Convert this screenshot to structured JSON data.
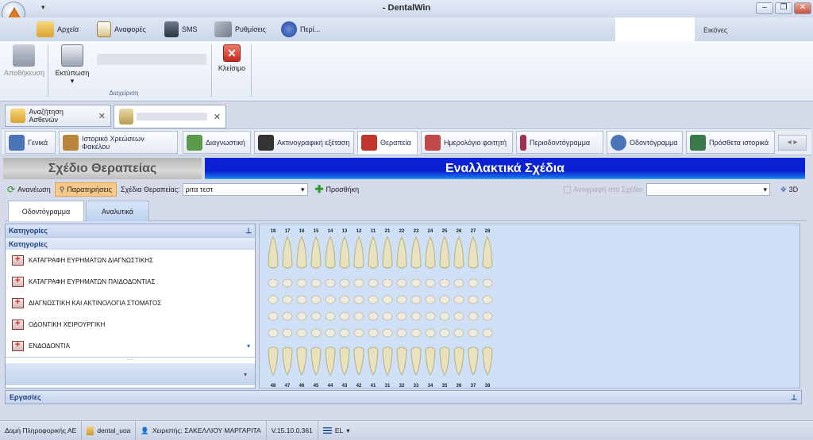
{
  "window": {
    "title": "- DentalWin",
    "qat_arrow": "▾",
    "min": "–",
    "restore": "❐",
    "close": "✕"
  },
  "menu": [
    {
      "label": "Αρχεία",
      "icon": "folder-icon"
    },
    {
      "label": "Αναφορές",
      "icon": "clipboard-icon"
    },
    {
      "label": "SMS",
      "icon": "phone-icon"
    },
    {
      "label": "Ρυθμίσεις",
      "icon": "tools-icon"
    },
    {
      "label": "Περί...",
      "icon": "info-icon"
    }
  ],
  "eikones": "Εικόνες",
  "ribbon": {
    "save": "Αποθήκευση",
    "print": "Εκτύπωση",
    "print_arrow": "▾",
    "close": "Κλείσιμο",
    "group": "Διαχείριση"
  },
  "doctabs": {
    "search": "Αναζήτηση Ασθενών",
    "x": "✕"
  },
  "sections": [
    {
      "label": "Γενικά",
      "color": "#4a73b8"
    },
    {
      "label": "Ιστορικό Χρεώσεων Φακέλου",
      "color": "#b9853a"
    },
    {
      "label": "Διαγνωστική",
      "color": "#5a9a4a"
    },
    {
      "label": "Ακτινογραφική εξέταση",
      "color": "#333333"
    },
    {
      "label": "Θεραπεία",
      "color": "#c2342c"
    },
    {
      "label": "Ημερολόγιο φοιτητή",
      "color": "#c04a4a"
    },
    {
      "label": "Περιοδοντόγραμμα",
      "color": "#a03050"
    },
    {
      "label": "Οδοντόγραμμα",
      "color": "#4a73b8"
    },
    {
      "label": "Πρόσθετα ιστορικά",
      "color": "#3a7a4a"
    }
  ],
  "headers": {
    "left": "Σχέδιο Θεραπείας",
    "right": "Εναλλακτικά Σχέδια"
  },
  "toolbar": {
    "refresh": "Ανανέωση",
    "notes": "Παρατηρήσεις",
    "plans_label": "Σχέδια Θεραπείας:",
    "plan_value": "ριτα τεστ",
    "add": "Προσθήκη",
    "copy": "Αντιγραφή στο Σχέδιο",
    "d3": "3D",
    "arrow": "▾"
  },
  "subtabs": {
    "odontogram": "Οδοντόγραμμα",
    "analytical": "Αναλυτικά"
  },
  "categories": {
    "header": "Κατηγορίες",
    "sub": "Κατηγορίες",
    "pin": "⊥",
    "items": [
      "ΚΑΤΑΓΡΑΦΗ ΕΥΡΗΜΑΤΩΝ ΔΙΑΓΝΩΣΤΙΚΗΣ",
      "ΚΑΤΑΓΡΑΦΗ ΕΥΡΗΜΑΤΩΝ ΠΑΙΔΟΔΟΝΤΙΑΣ",
      "ΔΙΑΓΝΩΣΤΙΚΗ ΚΑΙ ΑΚΤΙΝΟΛΟΓΙΑ ΣΤΟΜΑΤΟΣ",
      "ΟΔΟΝΤΙΚΗ ΧΕΙΡΟΥΡΓΙΚΗ",
      "ΕΝΔΟΔΟΝΤΙΑ"
    ],
    "grip": "·····",
    "scroll_down": "▾",
    "mini_arrow": "▾"
  },
  "teeth": {
    "upper": [
      "18",
      "17",
      "16",
      "15",
      "14",
      "13",
      "12",
      "11",
      "21",
      "22",
      "23",
      "24",
      "25",
      "26",
      "27",
      "28"
    ],
    "lower": [
      "48",
      "47",
      "46",
      "45",
      "44",
      "43",
      "42",
      "41",
      "31",
      "32",
      "33",
      "34",
      "35",
      "36",
      "37",
      "38"
    ]
  },
  "ergasies": {
    "label": "Εργασίες",
    "pin": "⊥"
  },
  "status": {
    "company": "Δομή Πληροφορικής ΑΕ",
    "db": "dental_uoa",
    "user": "Χειριστής: ΣΑΚΕΛΛΙΟΥ ΜΑΡΓΑΡΙΤΑ",
    "version": "V.15.10.0.361",
    "lang": "EL",
    "lang_arrow": "▾"
  }
}
